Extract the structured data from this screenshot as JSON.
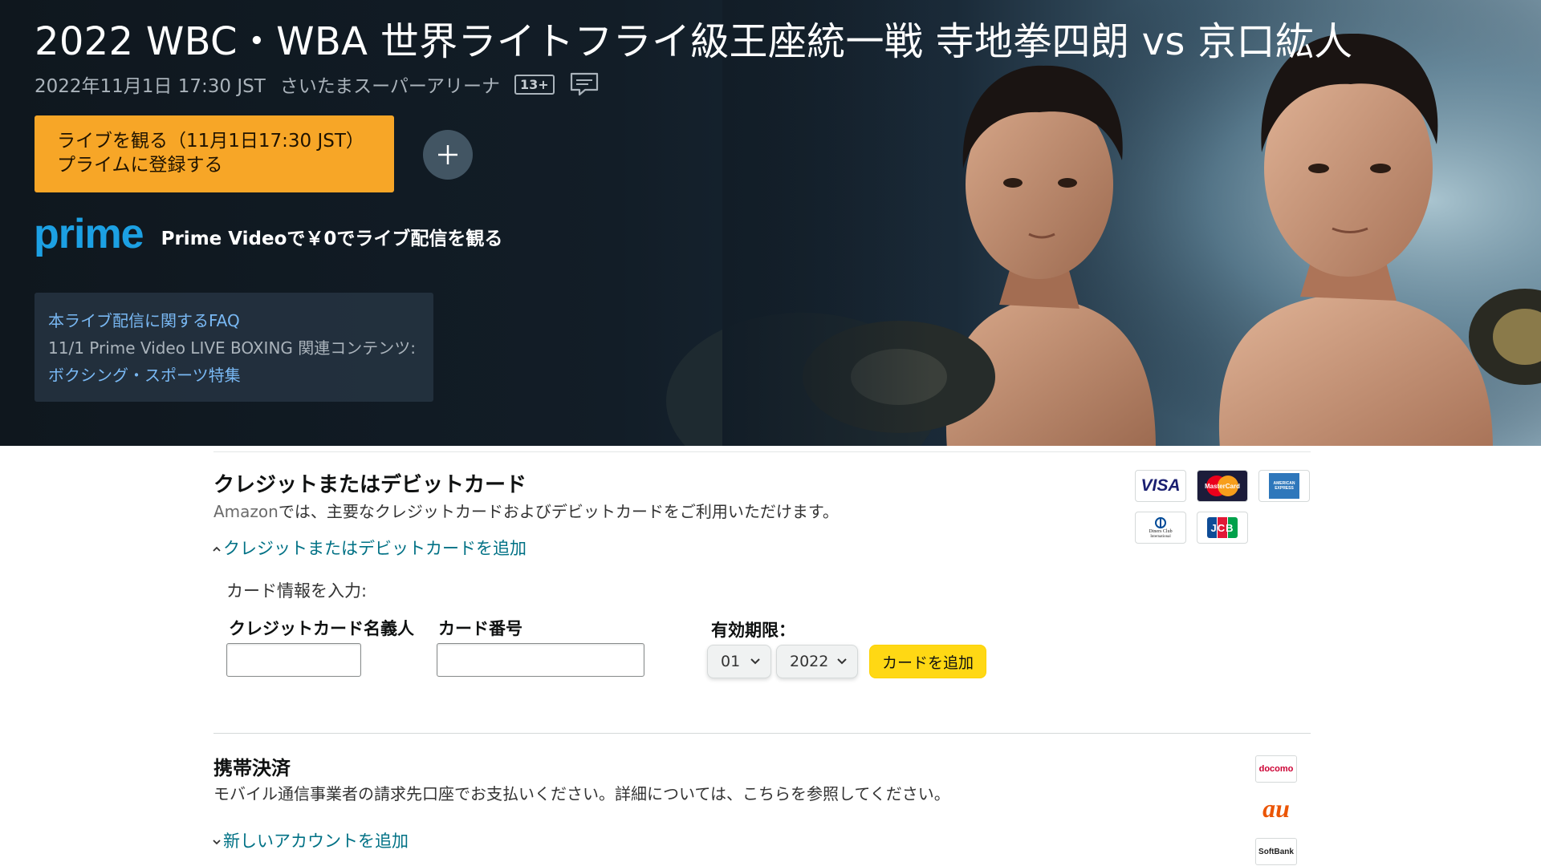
{
  "hero": {
    "title": "2022 WBC・WBA 世界ライトフライ級王座統一戦 寺地拳四朗 vs 京口紘人",
    "datetime": "2022年11月1日 17:30 JST",
    "venue": "さいたまスーパーアリーナ",
    "rating": "13+",
    "subtitle_icon": "subtitles-icon",
    "watch_button": {
      "line1": "ライブを観る（11月1日17:30 JST）",
      "line2": "プライムに登録する"
    },
    "add_icon": "plus-icon",
    "prime_logo_text": "prime",
    "prime_offer": "Prime Videoで￥0でライブ配信を観る",
    "faq": {
      "faq_link": "本ライブ配信に関するFAQ",
      "related_text": "11/1 Prime Video LIVE BOXING 関連コンテンツ:",
      "special_link": "ボクシング・スポーツ特集"
    }
  },
  "payment": {
    "card_section": {
      "heading": "クレジットまたはデビットカード",
      "desc_prefix": "Amazon",
      "desc_rest": "では、主要なクレジットカードおよびデビットカードをご利用いただけます。",
      "add_link": "クレジットまたはデビットカードを追加",
      "enter_label": "カード情報を入力:",
      "name_label": "クレジットカード名義人",
      "name_value": "",
      "number_label": "カード番号",
      "number_value": "",
      "expiry_label": "有効期限：",
      "expiry_month": "01",
      "expiry_year": "2022",
      "add_card_button": "カードを追加",
      "card_brands": {
        "visa": "VISA",
        "mastercard": "MasterCard",
        "amex": "AMERICAN EXPRESS",
        "diners_line1": "Diners Club",
        "diners_line2": "International",
        "jcb": "JCB"
      }
    },
    "mobile_section": {
      "heading": "携帯決済",
      "desc": "モバイル通信事業者の請求先口座でお支払いください。詳細については、こちらを参照してください。",
      "add_link": "新しいアカウントを追加",
      "carriers": {
        "docomo": "docomo",
        "au": "au",
        "softbank": "SoftBank"
      }
    }
  },
  "colors": {
    "hero_bg": "#0f171e",
    "watch_button": "#f7a627",
    "prime_blue": "#1ca0e3",
    "link_teal": "#007185",
    "add_card_yellow": "#ffd814"
  }
}
